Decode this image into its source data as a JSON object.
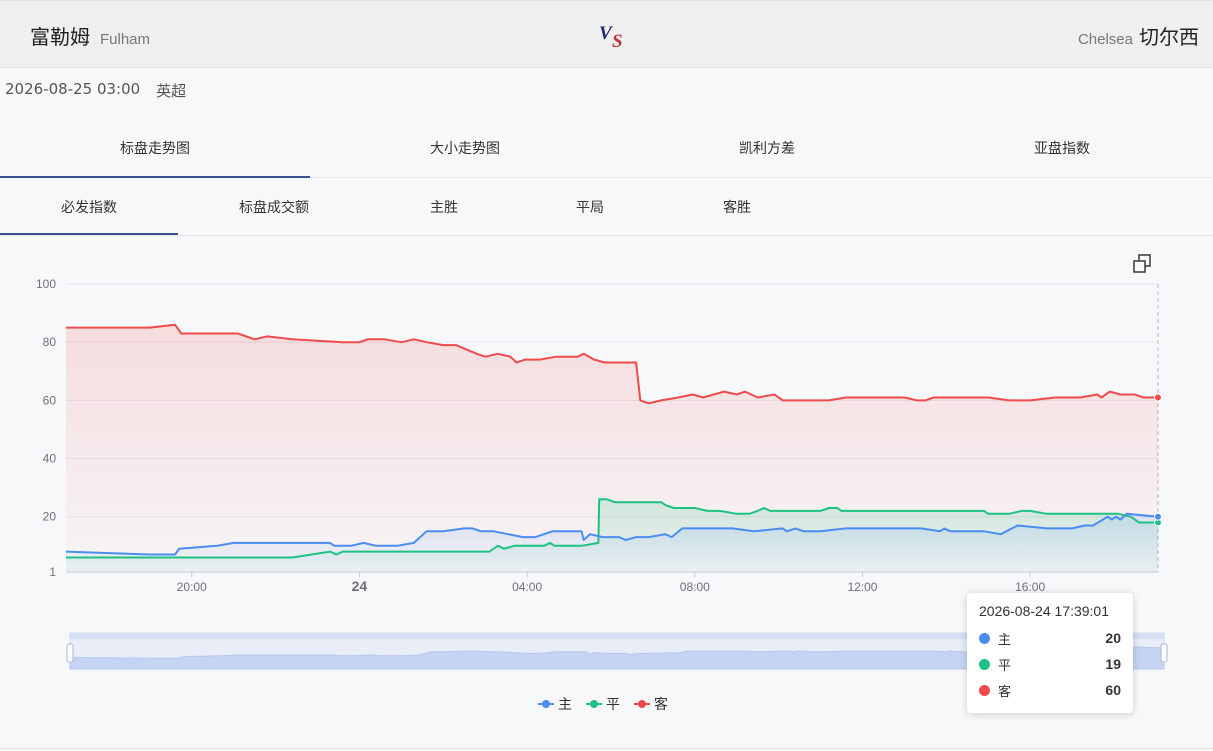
{
  "match": {
    "home_cn": "富勒姆",
    "home_en": "Fulham",
    "away_en": "Chelsea",
    "away_cn": "切尔西",
    "datetime": "2026-08-25 03:00",
    "league": "英超"
  },
  "tabs_primary": [
    "标盘走势图",
    "大小走势图",
    "凯利方差",
    "亚盘指数"
  ],
  "tabs_secondary": [
    "必发指数",
    "标盘成交额",
    "主胜",
    "平局",
    "客胜"
  ],
  "tooltip": {
    "time": "2026-08-24 17:39:01",
    "rows": [
      {
        "name": "主",
        "value": "20"
      },
      {
        "name": "平",
        "value": "19"
      },
      {
        "name": "客",
        "value": "60"
      }
    ]
  },
  "legend": [
    "主",
    "平",
    "客"
  ],
  "colors": {
    "home": "#4a8df0",
    "draw": "#1fc283",
    "away": "#ef4b4b",
    "accent": "#3d4e8c"
  },
  "chart_data": {
    "type": "line",
    "x_unit": "hour",
    "x_range": [
      17.0,
      17.68
    ],
    "x_start_reference": "2026-08-23 17:00",
    "x_ticks": [
      {
        "x": 20,
        "label": "20:00"
      },
      {
        "x": 24,
        "label": "24"
      },
      {
        "x": 28,
        "label": "04:00"
      },
      {
        "x": 32,
        "label": "08:00"
      },
      {
        "x": 36,
        "label": "12:00"
      },
      {
        "x": 40,
        "label": "16:00"
      }
    ],
    "y_ticks": [
      1,
      20,
      40,
      60,
      80,
      100
    ],
    "ylim": [
      1,
      100
    ],
    "series": [
      {
        "name": "主",
        "points": [
          [
            17.0,
            8
          ],
          [
            19.0,
            7
          ],
          [
            19.6,
            7
          ],
          [
            19.7,
            9
          ],
          [
            20.6,
            10
          ],
          [
            21.0,
            11
          ],
          [
            22.0,
            11
          ],
          [
            23.3,
            11
          ],
          [
            23.4,
            10
          ],
          [
            23.8,
            10
          ],
          [
            24.1,
            11
          ],
          [
            24.4,
            10
          ],
          [
            24.9,
            10
          ],
          [
            25.3,
            11
          ],
          [
            25.6,
            15
          ],
          [
            26.0,
            15
          ],
          [
            26.5,
            16
          ],
          [
            26.7,
            16
          ],
          [
            26.9,
            15
          ],
          [
            27.2,
            15
          ],
          [
            27.9,
            13
          ],
          [
            28.2,
            13
          ],
          [
            28.6,
            15
          ],
          [
            29.3,
            15
          ],
          [
            29.35,
            12
          ],
          [
            29.5,
            14
          ],
          [
            29.8,
            13
          ],
          [
            30.2,
            13
          ],
          [
            30.35,
            12
          ],
          [
            30.6,
            13
          ],
          [
            30.9,
            13
          ],
          [
            31.3,
            14
          ],
          [
            31.45,
            13
          ],
          [
            31.7,
            16
          ],
          [
            32.5,
            16
          ],
          [
            32.9,
            16
          ],
          [
            33.4,
            15
          ],
          [
            34.1,
            16
          ],
          [
            34.2,
            15
          ],
          [
            34.4,
            16
          ],
          [
            34.6,
            15
          ],
          [
            35.0,
            15
          ],
          [
            35.6,
            16
          ],
          [
            37.0,
            16
          ],
          [
            37.4,
            16
          ],
          [
            37.85,
            15
          ],
          [
            37.95,
            16
          ],
          [
            38.1,
            15
          ],
          [
            38.9,
            15
          ],
          [
            39.3,
            14
          ],
          [
            39.7,
            17
          ],
          [
            40.4,
            16
          ],
          [
            41.0,
            16
          ],
          [
            41.3,
            17
          ],
          [
            41.5,
            17
          ],
          [
            41.85,
            20
          ],
          [
            41.95,
            19
          ],
          [
            42.05,
            20
          ],
          [
            42.15,
            19
          ],
          [
            42.3,
            21
          ],
          [
            43.05,
            20
          ]
        ]
      },
      {
        "name": "平",
        "points": [
          [
            17.0,
            6
          ],
          [
            21.8,
            6
          ],
          [
            22.4,
            6
          ],
          [
            23.3,
            8
          ],
          [
            23.45,
            7
          ],
          [
            23.6,
            8
          ],
          [
            25.0,
            8
          ],
          [
            27.1,
            8
          ],
          [
            27.3,
            10
          ],
          [
            27.45,
            9
          ],
          [
            27.7,
            10
          ],
          [
            28.4,
            10
          ],
          [
            28.55,
            11
          ],
          [
            28.65,
            10
          ],
          [
            29.3,
            10
          ],
          [
            29.7,
            11
          ],
          [
            29.72,
            26
          ],
          [
            29.9,
            26
          ],
          [
            30.1,
            25
          ],
          [
            31.2,
            25
          ],
          [
            31.3,
            24
          ],
          [
            31.5,
            23
          ],
          [
            32.0,
            23
          ],
          [
            32.3,
            22
          ],
          [
            32.6,
            22
          ],
          [
            33.0,
            21
          ],
          [
            33.3,
            21
          ],
          [
            33.5,
            22
          ],
          [
            33.65,
            23
          ],
          [
            33.8,
            22
          ],
          [
            34.2,
            22
          ],
          [
            34.5,
            22
          ],
          [
            34.8,
            22
          ],
          [
            35.0,
            22
          ],
          [
            35.2,
            23
          ],
          [
            35.4,
            23
          ],
          [
            35.5,
            22
          ],
          [
            36.0,
            22
          ],
          [
            37.0,
            22
          ],
          [
            38.0,
            22
          ],
          [
            38.9,
            22
          ],
          [
            39.0,
            21
          ],
          [
            39.2,
            21
          ],
          [
            39.5,
            21
          ],
          [
            39.8,
            22
          ],
          [
            40.0,
            22
          ],
          [
            40.4,
            21
          ],
          [
            41.4,
            21
          ],
          [
            41.7,
            21
          ],
          [
            42.1,
            21
          ],
          [
            42.4,
            20
          ],
          [
            42.6,
            18
          ],
          [
            43.05,
            18
          ]
        ]
      },
      {
        "name": "客",
        "points": [
          [
            17.0,
            85
          ],
          [
            19.0,
            85
          ],
          [
            19.6,
            86
          ],
          [
            19.75,
            83
          ],
          [
            20.6,
            83
          ],
          [
            21.1,
            83
          ],
          [
            21.5,
            81
          ],
          [
            21.8,
            82
          ],
          [
            22.4,
            81
          ],
          [
            23.6,
            80
          ],
          [
            24.0,
            80
          ],
          [
            24.2,
            81
          ],
          [
            24.6,
            81
          ],
          [
            25.0,
            80
          ],
          [
            25.3,
            81
          ],
          [
            25.6,
            80
          ],
          [
            26.0,
            79
          ],
          [
            26.3,
            79
          ],
          [
            26.8,
            76
          ],
          [
            27.0,
            75
          ],
          [
            27.3,
            76
          ],
          [
            27.6,
            75
          ],
          [
            27.75,
            73
          ],
          [
            27.95,
            74
          ],
          [
            28.3,
            74
          ],
          [
            28.7,
            75
          ],
          [
            29.2,
            75
          ],
          [
            29.35,
            76
          ],
          [
            29.6,
            74
          ],
          [
            29.85,
            73
          ],
          [
            30.6,
            73
          ],
          [
            30.7,
            60
          ],
          [
            30.9,
            59
          ],
          [
            31.2,
            60
          ],
          [
            31.6,
            61
          ],
          [
            31.95,
            62
          ],
          [
            32.2,
            61
          ],
          [
            32.45,
            62
          ],
          [
            32.7,
            63
          ],
          [
            33.0,
            62
          ],
          [
            33.2,
            63
          ],
          [
            33.5,
            61
          ],
          [
            33.9,
            62
          ],
          [
            34.1,
            60
          ],
          [
            34.8,
            60
          ],
          [
            35.2,
            60
          ],
          [
            35.6,
            61
          ],
          [
            36.0,
            61
          ],
          [
            36.5,
            61
          ],
          [
            37.0,
            61
          ],
          [
            37.3,
            60
          ],
          [
            37.5,
            60
          ],
          [
            37.7,
            61
          ],
          [
            38.2,
            61
          ],
          [
            39.0,
            61
          ],
          [
            39.5,
            60
          ],
          [
            40.0,
            60
          ],
          [
            40.6,
            61
          ],
          [
            41.2,
            61
          ],
          [
            41.6,
            62
          ],
          [
            41.7,
            61
          ],
          [
            41.9,
            63
          ],
          [
            42.15,
            62
          ],
          [
            42.5,
            62
          ],
          [
            42.7,
            61
          ],
          [
            43.05,
            61
          ]
        ]
      }
    ],
    "title": "",
    "xlabel": "",
    "ylabel": "",
    "grid": true,
    "legend_position": "bottom"
  }
}
